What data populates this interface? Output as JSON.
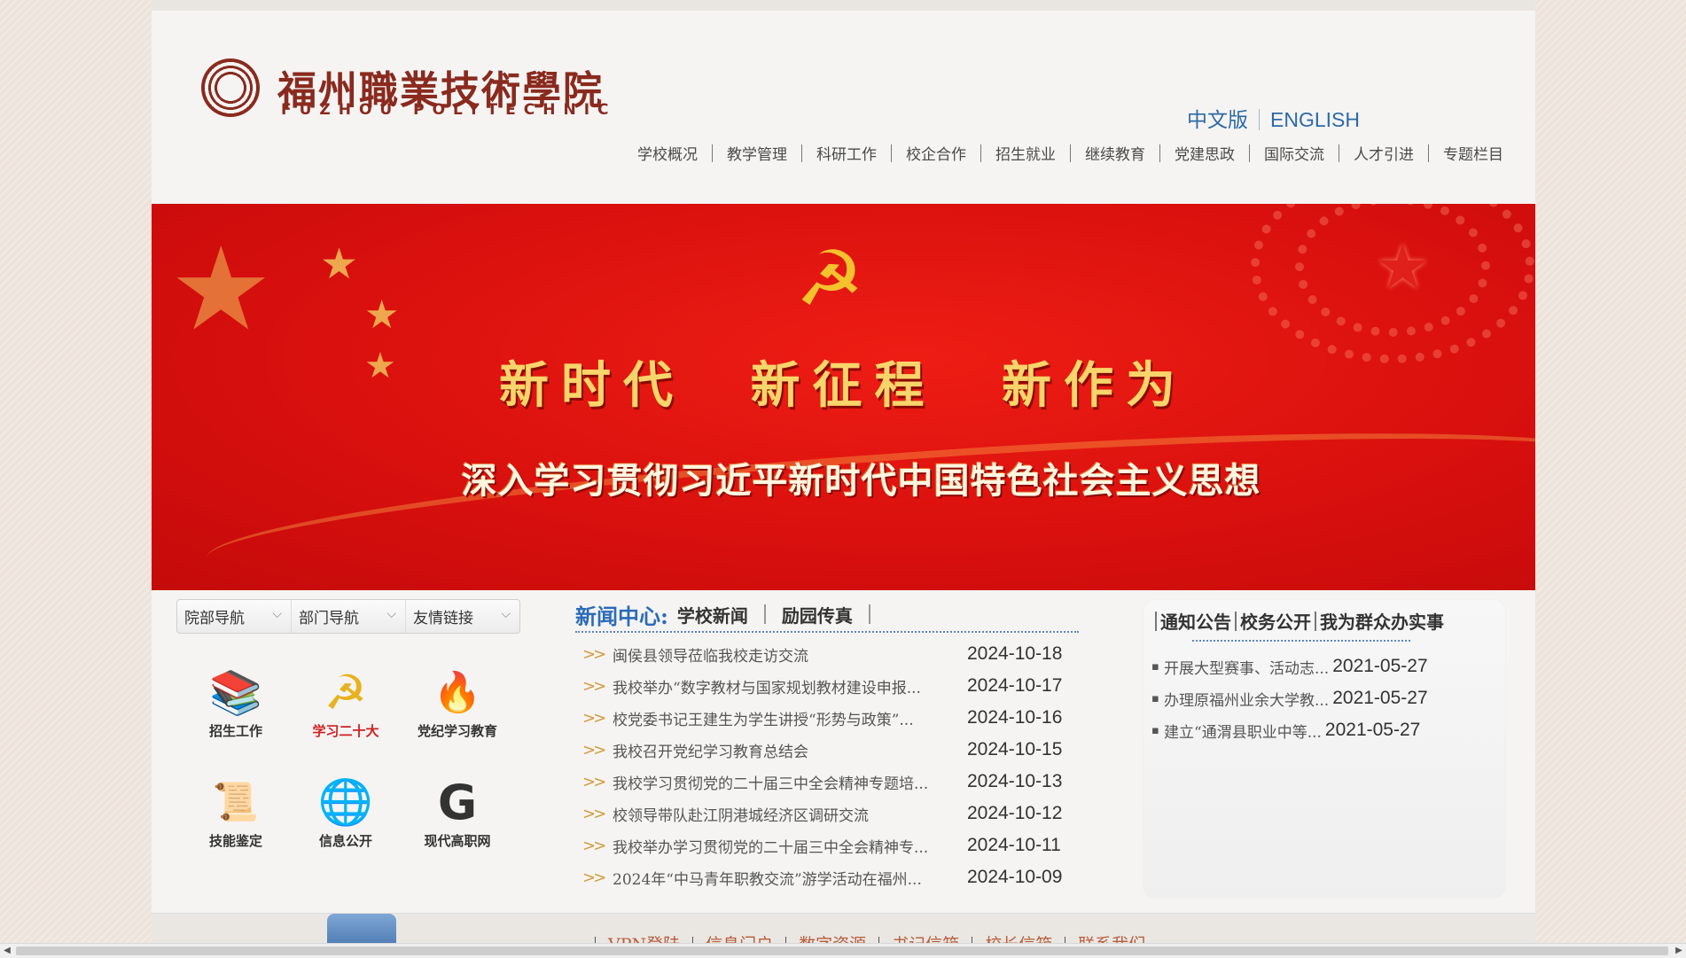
{
  "header": {
    "logo_cn": "福州職業技術學院",
    "logo_en": "FUZHOU POLYTECHNIC",
    "lang": [
      "中文版",
      "ENGLISH"
    ]
  },
  "nav": [
    "学校概况",
    "教学管理",
    "科研工作",
    "校企合作",
    "招生就业",
    "继续教育",
    "党建思政",
    "国际交流",
    "人才引进",
    "专题栏目"
  ],
  "banner": {
    "slogan1": "新时代 新征程 新作为",
    "slogan2": "深入学习贯彻习近平新时代中国特色社会主义思想"
  },
  "left": {
    "tabs": [
      "院部导航",
      "部门导航",
      "友情链接"
    ],
    "icons": [
      {
        "label": "招生工作",
        "icon": "book-stack-icon"
      },
      {
        "label": "学习二十大",
        "icon": "hammer-sickle-icon"
      },
      {
        "label": "党纪学习教育",
        "icon": "torch-figure-icon"
      },
      {
        "label": "技能鉴定",
        "icon": "certificate-icon"
      },
      {
        "label": "信息公开",
        "icon": "globe-icon"
      },
      {
        "label": "现代高职网",
        "icon": "g-logo-icon"
      }
    ]
  },
  "news": {
    "title": "新闻中心:",
    "tabs": [
      "学校新闻",
      "励园传真"
    ],
    "items": [
      {
        "title": "闽侯县领导莅临我校走访交流",
        "date": "2024-10-18"
      },
      {
        "title": "我校举办“数字教材与国家规划教材建设申报...",
        "date": "2024-10-17"
      },
      {
        "title": "校党委书记王建生为学生讲授“形势与政策”...",
        "date": "2024-10-16"
      },
      {
        "title": "我校召开党纪学习教育总结会",
        "date": "2024-10-15"
      },
      {
        "title": "我校学习贯彻党的二十届三中全会精神专题培...",
        "date": "2024-10-13"
      },
      {
        "title": "校领导带队赴江阴港城经济区调研交流",
        "date": "2024-10-12"
      },
      {
        "title": "我校举办学习贯彻党的二十届三中全会精神专...",
        "date": "2024-10-11"
      },
      {
        "title": "2024年“中马青年职教交流”游学活动在福州...",
        "date": "2024-10-09"
      }
    ]
  },
  "notice": {
    "tabs": [
      "通知公告",
      "校务公开",
      "我为群众办实事"
    ],
    "items": [
      {
        "title": "开展大型赛事、活动志...",
        "date": "2021-05-27"
      },
      {
        "title": "办理原福州业余大学教...",
        "date": "2021-05-27"
      },
      {
        "title": "建立“通渭县职业中等...",
        "date": "2021-05-27"
      }
    ]
  },
  "footer": {
    "links": [
      "VPN登陆",
      "信息门户",
      "数字资源",
      "书记信箱",
      "校长信箱",
      "联系我们"
    ]
  },
  "colors": {
    "brand_red": "#8a2a1e",
    "banner_red": "#d9100e",
    "accent_blue": "#2b6cb8",
    "arrow_gold": "#d39a3a"
  }
}
